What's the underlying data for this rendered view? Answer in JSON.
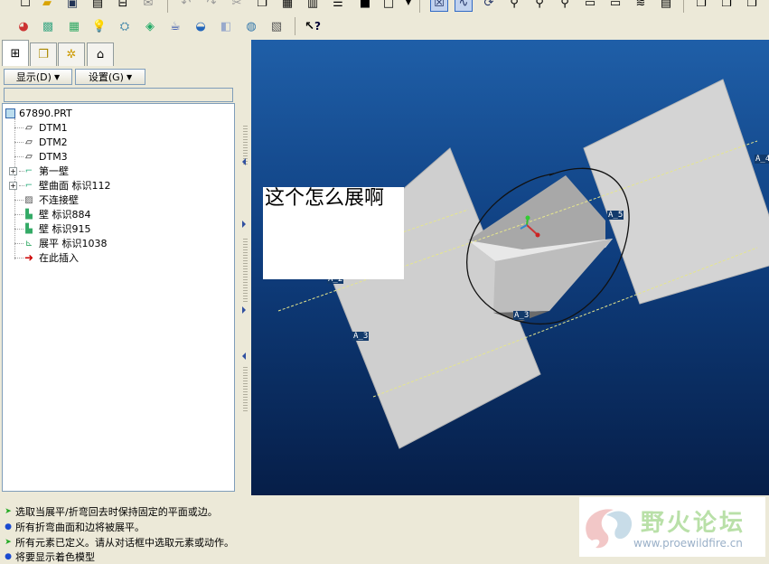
{
  "toolbar_top": {
    "icons": [
      "new-icon",
      "open-icon",
      "save-icon",
      "print-icon",
      "send-icon",
      "email-icon",
      "undo-icon",
      "redo-icon",
      "cut-icon",
      "copy-icon",
      "paste-icon",
      "paste-special-icon",
      "regenerate-icon",
      "model-tree-icon",
      "window-icon",
      "dropdown-icon",
      "datum-display-icon",
      "sketch-icon",
      "rotate-icon",
      "zoom-in-icon",
      "zoom-out-icon",
      "refit-icon",
      "view-icon",
      "orient-icon",
      "layers-icon",
      "saved-views-icon",
      "wireframe-icon",
      "hidden-line-icon",
      "shading-icon"
    ]
  },
  "toolbar_second": {
    "icons": [
      "appearance-icon",
      "scene-icon",
      "texture-icon",
      "light-icon",
      "perspective-icon",
      "environment-icon",
      "teapot-icon",
      "shade-icon",
      "box-icon",
      "globe-icon",
      "tools-icon",
      "context-help-icon"
    ],
    "help_glyph": "?"
  },
  "model_tree": {
    "tabs": [
      "model-tree-tab",
      "layer-tab",
      "folder-tab",
      "favorites-tab"
    ],
    "show_menu": "显示(D)",
    "settings_menu": "设置(G)",
    "root": "67890.PRT",
    "items": [
      {
        "label": "DTM1",
        "icon": "datum-plane-icon",
        "expandable": false
      },
      {
        "label": "DTM2",
        "icon": "datum-plane-icon",
        "expandable": false
      },
      {
        "label": "DTM3",
        "icon": "datum-plane-icon",
        "expandable": false
      },
      {
        "label": "第一壁",
        "icon": "first-wall-icon",
        "expandable": true
      },
      {
        "label": "壁曲面 标识112",
        "icon": "wall-surface-icon",
        "expandable": true
      },
      {
        "label": "不连接壁",
        "icon": "unattached-wall-icon",
        "expandable": false
      },
      {
        "label": "壁 标识884",
        "icon": "wall-icon",
        "expandable": false
      },
      {
        "label": "壁 标识915",
        "icon": "wall-icon",
        "expandable": false
      },
      {
        "label": "展平 标识1038",
        "icon": "unbend-icon",
        "expandable": false
      },
      {
        "label": "在此插入",
        "icon": "insert-here-arrow-icon",
        "expandable": false
      }
    ]
  },
  "viewport": {
    "annotation": "这个怎么展啊",
    "datum_labels": [
      "A_4",
      "A_5",
      "A_2",
      "A_3",
      "A_3"
    ],
    "colors": {
      "bg_top": "#1f5fa8",
      "bg_bottom": "#061e48",
      "part": "#c8c8c8",
      "axis": "#e6e68c"
    }
  },
  "messages": [
    {
      "icon": "arrow-green-icon",
      "text": "选取当展平/折弯回去时保持固定的平面或边。"
    },
    {
      "icon": "dot-blue-icon",
      "text": "所有折弯曲面和边将被展平。"
    },
    {
      "icon": "arrow-green-icon",
      "text": "所有元素已定义。请从对话框中选取元素或动作。"
    },
    {
      "icon": "dot-blue-icon",
      "text": "将要显示着色模型"
    }
  ],
  "watermark": {
    "title": "野火论坛",
    "url": "www.proewildfire.cn"
  }
}
